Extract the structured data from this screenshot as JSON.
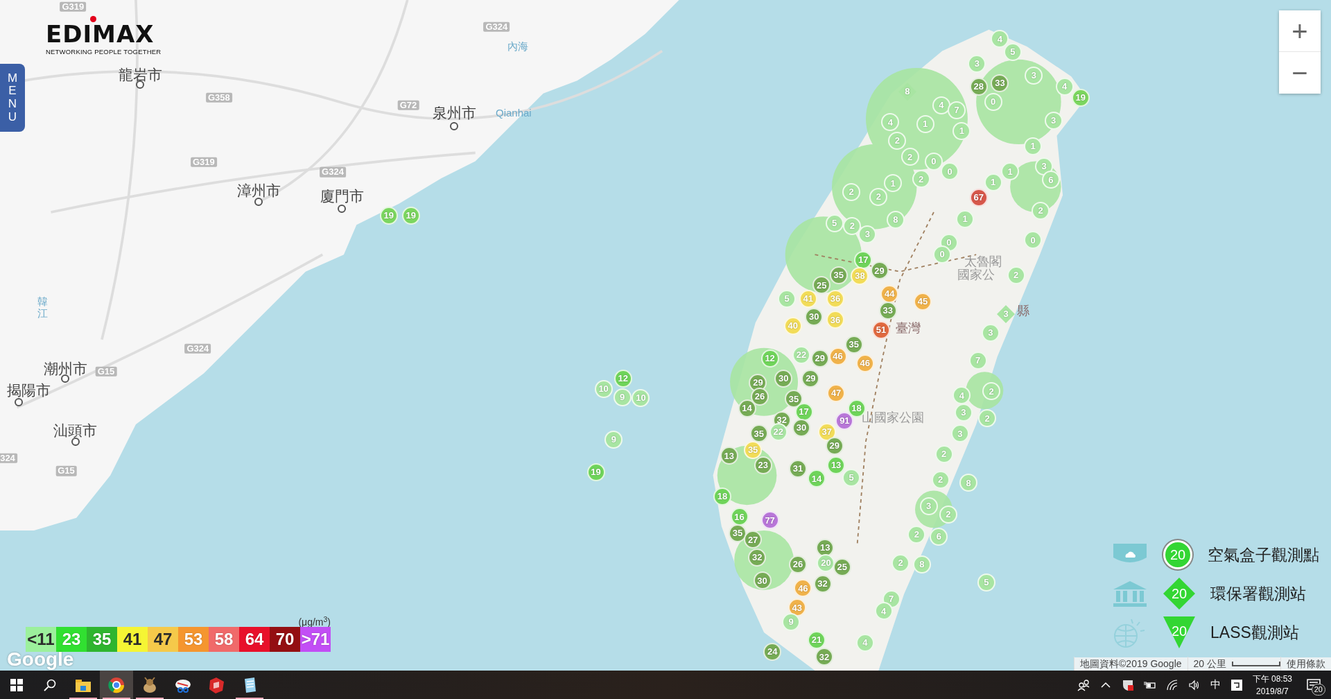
{
  "logo": {
    "name": "EDIMAX",
    "tagline": "NETWORKING PEOPLE TOGETHER"
  },
  "menu_tab": {
    "label": "MENU"
  },
  "zoom_controls": [
    {
      "kind": "in",
      "label": "+"
    },
    {
      "kind": "out",
      "label": "−"
    }
  ],
  "map_labels": [
    {
      "text": "龍岩市",
      "kind": "city"
    },
    {
      "text": "泉州市",
      "kind": "city"
    },
    {
      "text": "漳州市",
      "kind": "city"
    },
    {
      "text": "廈門市",
      "kind": "city"
    },
    {
      "text": "潮州市",
      "kind": "city"
    },
    {
      "text": "揭陽市",
      "kind": "city"
    },
    {
      "text": "汕頭市",
      "kind": "city"
    },
    {
      "text": "Qianhai",
      "kind": "water"
    },
    {
      "text": "內海",
      "kind": "water"
    },
    {
      "text": "韓江",
      "kind": "river"
    },
    {
      "text": "太魯閣",
      "kind": "park"
    },
    {
      "text": "國家公",
      "kind": "park"
    },
    {
      "text": "山國家公園",
      "kind": "park"
    },
    {
      "text": "臺灣",
      "kind": "region"
    },
    {
      "text": "縣",
      "kind": "region"
    },
    {
      "text": "G319",
      "kind": "road"
    },
    {
      "text": "G324",
      "kind": "road"
    },
    {
      "text": "G358",
      "kind": "road"
    },
    {
      "text": "G72",
      "kind": "road"
    },
    {
      "text": "G319",
      "kind": "road"
    },
    {
      "text": "G324",
      "kind": "road"
    },
    {
      "text": "G324",
      "kind": "road"
    },
    {
      "text": "G15",
      "kind": "road"
    },
    {
      "text": "G15",
      "kind": "road"
    },
    {
      "text": "324",
      "kind": "road"
    }
  ],
  "markers": [
    {
      "value": "19",
      "color": "#7bd65f",
      "kind": "circle"
    },
    {
      "value": "19",
      "color": "#7bd65f",
      "kind": "circle"
    },
    {
      "value": "4",
      "color": "#a8e5a2",
      "kind": "circle"
    },
    {
      "value": "5",
      "color": "#a8e5a2",
      "kind": "circle"
    },
    {
      "value": "3",
      "color": "#a8e5a2",
      "kind": "circle"
    },
    {
      "value": "28",
      "color": "#76ab55",
      "kind": "circle"
    },
    {
      "value": "33",
      "color": "#76ab55",
      "kind": "circle"
    },
    {
      "value": "0",
      "color": "#a8e5a2",
      "kind": "circle"
    },
    {
      "value": "3",
      "color": "#a8e5a2",
      "kind": "circle"
    },
    {
      "value": "4",
      "color": "#a8e5a2",
      "kind": "circle"
    },
    {
      "value": "19",
      "color": "#7bd65f",
      "kind": "circle"
    },
    {
      "value": "8",
      "color": "#a8e5a2",
      "kind": "diamond"
    },
    {
      "value": "4",
      "color": "#a8e5a2",
      "kind": "circle"
    },
    {
      "value": "7",
      "color": "#a8e5a2",
      "kind": "circle"
    },
    {
      "value": "1",
      "color": "#a8e5a2",
      "kind": "circle"
    },
    {
      "value": "1",
      "color": "#a8e5a2",
      "kind": "circle"
    },
    {
      "value": "4",
      "color": "#a8e5a2",
      "kind": "circle"
    },
    {
      "value": "2",
      "color": "#a8e5a2",
      "kind": "circle"
    },
    {
      "value": "2",
      "color": "#a8e5a2",
      "kind": "circle"
    },
    {
      "value": "0",
      "color": "#a8e5a2",
      "kind": "circle"
    },
    {
      "value": "0",
      "color": "#a8e5a2",
      "kind": "circle"
    },
    {
      "value": "2",
      "color": "#a8e5a2",
      "kind": "circle"
    },
    {
      "value": "1",
      "color": "#a8e5a2",
      "kind": "circle"
    },
    {
      "value": "2",
      "color": "#a8e5a2",
      "kind": "circle"
    },
    {
      "value": "2",
      "color": "#a8e5a2",
      "kind": "circle"
    },
    {
      "value": "5",
      "color": "#a8e5a2",
      "kind": "circle"
    },
    {
      "value": "2",
      "color": "#a8e5a2",
      "kind": "circle"
    },
    {
      "value": "3",
      "color": "#a8e5a2",
      "kind": "circle"
    },
    {
      "value": "8",
      "color": "#a8e5a2",
      "kind": "circle"
    },
    {
      "value": "1",
      "color": "#a8e5a2",
      "kind": "circle"
    },
    {
      "value": "3",
      "color": "#a8e5a2",
      "kind": "circle"
    },
    {
      "value": "6",
      "color": "#a8e5a2",
      "kind": "circle"
    },
    {
      "value": "1",
      "color": "#a8e5a2",
      "kind": "circle"
    },
    {
      "value": "1",
      "color": "#a8e5a2",
      "kind": "circle"
    },
    {
      "value": "67",
      "color": "#d6574a",
      "kind": "circle"
    },
    {
      "value": "1",
      "color": "#a8e5a2",
      "kind": "circle"
    },
    {
      "value": "2",
      "color": "#a8e5a2",
      "kind": "circle"
    },
    {
      "value": "0",
      "color": "#a8e5a2",
      "kind": "circle"
    },
    {
      "value": "0",
      "color": "#a8e5a2",
      "kind": "circle"
    },
    {
      "value": "0",
      "color": "#a8e5a2",
      "kind": "circle"
    },
    {
      "value": "2",
      "color": "#a8e5a2",
      "kind": "circle"
    },
    {
      "value": "3",
      "color": "#a8e5a2",
      "kind": "circle"
    },
    {
      "value": "17",
      "color": "#6fd45a",
      "kind": "circle"
    },
    {
      "value": "29",
      "color": "#76ab55",
      "kind": "circle"
    },
    {
      "value": "35",
      "color": "#76ab55",
      "kind": "circle"
    },
    {
      "value": "25",
      "color": "#76ab55",
      "kind": "circle"
    },
    {
      "value": "38",
      "color": "#f2dc58",
      "kind": "circle"
    },
    {
      "value": "5",
      "color": "#a8e5a2",
      "kind": "circle"
    },
    {
      "value": "41",
      "color": "#f2dc58",
      "kind": "circle"
    },
    {
      "value": "36",
      "color": "#f2dc58",
      "kind": "circle"
    },
    {
      "value": "44",
      "color": "#f0b24a",
      "kind": "circle"
    },
    {
      "value": "45",
      "color": "#f0b24a",
      "kind": "circle"
    },
    {
      "value": "33",
      "color": "#76ab55",
      "kind": "circle"
    },
    {
      "value": "40",
      "color": "#f2dc58",
      "kind": "circle"
    },
    {
      "value": "30",
      "color": "#76ab55",
      "kind": "circle"
    },
    {
      "value": "36",
      "color": "#f2dc58",
      "kind": "circle"
    },
    {
      "value": "51",
      "color": "#e0693f",
      "kind": "circle"
    },
    {
      "value": "35",
      "color": "#76ab55",
      "kind": "circle"
    },
    {
      "value": "12",
      "color": "#6fd45a",
      "kind": "circle"
    },
    {
      "value": "22",
      "color": "#a8e5a2",
      "kind": "circle"
    },
    {
      "value": "29",
      "color": "#76ab55",
      "kind": "circle"
    },
    {
      "value": "46",
      "color": "#f0b24a",
      "kind": "circle"
    },
    {
      "value": "46",
      "color": "#f0b24a",
      "kind": "circle"
    },
    {
      "value": "30",
      "color": "#76ab55",
      "kind": "circle"
    },
    {
      "value": "29",
      "color": "#76ab55",
      "kind": "circle"
    },
    {
      "value": "29",
      "color": "#76ab55",
      "kind": "circle"
    },
    {
      "value": "26",
      "color": "#76ab55",
      "kind": "circle"
    },
    {
      "value": "35",
      "color": "#76ab55",
      "kind": "circle"
    },
    {
      "value": "47",
      "color": "#f0b24a",
      "kind": "circle"
    },
    {
      "value": "14",
      "color": "#76ab55",
      "kind": "circle"
    },
    {
      "value": "18",
      "color": "#6fd45a",
      "kind": "circle"
    },
    {
      "value": "32",
      "color": "#76ab55",
      "kind": "circle"
    },
    {
      "value": "17",
      "color": "#6fd45a",
      "kind": "circle"
    },
    {
      "value": "91",
      "color": "#b876d8",
      "kind": "circle"
    },
    {
      "value": "35",
      "color": "#76ab55",
      "kind": "circle"
    },
    {
      "value": "22",
      "color": "#a8e5a2",
      "kind": "circle"
    },
    {
      "value": "30",
      "color": "#76ab55",
      "kind": "circle"
    },
    {
      "value": "37",
      "color": "#f2dc58",
      "kind": "circle"
    },
    {
      "value": "29",
      "color": "#76ab55",
      "kind": "circle"
    },
    {
      "value": "13",
      "color": "#76ab55",
      "kind": "circle"
    },
    {
      "value": "35",
      "color": "#f2dc58",
      "kind": "circle"
    },
    {
      "value": "23",
      "color": "#76ab55",
      "kind": "circle"
    },
    {
      "value": "31",
      "color": "#76ab55",
      "kind": "circle"
    },
    {
      "value": "13",
      "color": "#6fd45a",
      "kind": "circle"
    },
    {
      "value": "14",
      "color": "#6fd45a",
      "kind": "circle"
    },
    {
      "value": "5",
      "color": "#a8e5a2",
      "kind": "circle"
    },
    {
      "value": "18",
      "color": "#6fd45a",
      "kind": "circle"
    },
    {
      "value": "16",
      "color": "#6fd45a",
      "kind": "circle"
    },
    {
      "value": "77",
      "color": "#b876d8",
      "kind": "circle"
    },
    {
      "value": "35",
      "color": "#76ab55",
      "kind": "circle"
    },
    {
      "value": "27",
      "color": "#76ab55",
      "kind": "circle"
    },
    {
      "value": "32",
      "color": "#76ab55",
      "kind": "circle"
    },
    {
      "value": "13",
      "color": "#76ab55",
      "kind": "circle"
    },
    {
      "value": "26",
      "color": "#76ab55",
      "kind": "circle"
    },
    {
      "value": "20",
      "color": "#a8e5a2",
      "kind": "circle"
    },
    {
      "value": "25",
      "color": "#76ab55",
      "kind": "circle"
    },
    {
      "value": "30",
      "color": "#76ab55",
      "kind": "circle"
    },
    {
      "value": "32",
      "color": "#76ab55",
      "kind": "circle"
    },
    {
      "value": "46",
      "color": "#f0b24a",
      "kind": "circle"
    },
    {
      "value": "43",
      "color": "#f0b24a",
      "kind": "circle"
    },
    {
      "value": "9",
      "color": "#a8e5a2",
      "kind": "circle"
    },
    {
      "value": "21",
      "color": "#6fd45a",
      "kind": "circle"
    },
    {
      "value": "24",
      "color": "#76ab55",
      "kind": "circle"
    },
    {
      "value": "32",
      "color": "#76ab55",
      "kind": "circle"
    },
    {
      "value": "4",
      "color": "#a8e5a2",
      "kind": "circle"
    },
    {
      "value": "2",
      "color": "#a8e5a2",
      "kind": "circle"
    },
    {
      "value": "3",
      "color": "#a8e5a2",
      "kind": "circle"
    },
    {
      "value": "2",
      "color": "#a8e5a2",
      "kind": "circle"
    },
    {
      "value": "3",
      "color": "#a8e5a2",
      "kind": "circle"
    },
    {
      "value": "2",
      "color": "#a8e5a2",
      "kind": "circle"
    },
    {
      "value": "2",
      "color": "#a8e5a2",
      "kind": "circle"
    },
    {
      "value": "8",
      "color": "#a8e5a2",
      "kind": "circle"
    },
    {
      "value": "3",
      "color": "#a8e5a2",
      "kind": "circle"
    },
    {
      "value": "2",
      "color": "#a8e5a2",
      "kind": "circle"
    },
    {
      "value": "2",
      "color": "#a8e5a2",
      "kind": "circle"
    },
    {
      "value": "6",
      "color": "#a8e5a2",
      "kind": "circle"
    },
    {
      "value": "2",
      "color": "#a8e5a2",
      "kind": "circle"
    },
    {
      "value": "8",
      "color": "#a8e5a2",
      "kind": "circle"
    },
    {
      "value": "7",
      "color": "#a8e5a2",
      "kind": "circle"
    },
    {
      "value": "4",
      "color": "#a8e5a2",
      "kind": "circle"
    },
    {
      "value": "4",
      "color": "#a8e5a2",
      "kind": "circle"
    },
    {
      "value": "5",
      "color": "#a8e5a2",
      "kind": "circle"
    },
    {
      "value": "3",
      "color": "#a8e5a2",
      "kind": "circle"
    },
    {
      "value": "7",
      "color": "#a8e5a2",
      "kind": "circle"
    },
    {
      "value": "3",
      "color": "#a8e5a2",
      "kind": "diamond"
    },
    {
      "value": "12",
      "color": "#6fd45a",
      "kind": "circle"
    },
    {
      "value": "10",
      "color": "#a8e5a2",
      "kind": "circle"
    },
    {
      "value": "9",
      "color": "#a8e5a2",
      "kind": "circle"
    },
    {
      "value": "10",
      "color": "#a8e5a2",
      "kind": "circle"
    },
    {
      "value": "9",
      "color": "#a8e5a2",
      "kind": "circle"
    },
    {
      "value": "19",
      "color": "#6fd45a",
      "kind": "circle"
    }
  ],
  "pm25_legend": {
    "unit": "(μg/m$^{3}$)",
    "levels": [
      {
        "label": "<11",
        "color": "#9cf09c"
      },
      {
        "label": "23",
        "color": "#31e031"
      },
      {
        "label": "35",
        "color": "#2fb52f"
      },
      {
        "label": "41",
        "color": "#f5f534"
      },
      {
        "label": "47",
        "color": "#f5c94a"
      },
      {
        "label": "53",
        "color": "#f5962f"
      },
      {
        "label": "58",
        "color": "#f06a6a"
      },
      {
        "label": "64",
        "color": "#e8102a"
      },
      {
        "label": "70",
        "color": "#940f12"
      },
      {
        "label": ">71",
        "color": "#c24ef5"
      }
    ]
  },
  "source_legend": [
    {
      "kind": "airbox",
      "value": "20",
      "label": "空氣盒子觀測點"
    },
    {
      "kind": "epa",
      "value": "20",
      "label": "環保署觀測站"
    },
    {
      "kind": "lass",
      "value": "20",
      "label": "LASS觀測站"
    }
  ],
  "google_logo": "Google",
  "attribution": {
    "map_data": "地圖資料©2019 Google",
    "scale": "20 公里",
    "terms": "使用條款"
  },
  "taskbar": {
    "apps": [
      {
        "kind": "folder",
        "selected": false,
        "running": true
      },
      {
        "kind": "browser",
        "selected": true,
        "running": true
      },
      {
        "kind": "bird",
        "selected": false,
        "running": true
      },
      {
        "kind": "scissors",
        "selected": false,
        "running": false
      },
      {
        "kind": "cube",
        "selected": false,
        "running": false
      },
      {
        "kind": "notepad",
        "selected": false,
        "running": true
      }
    ],
    "ime": "中",
    "time": "下午 08:53",
    "date": "2019/8/7",
    "notifications": "20"
  }
}
